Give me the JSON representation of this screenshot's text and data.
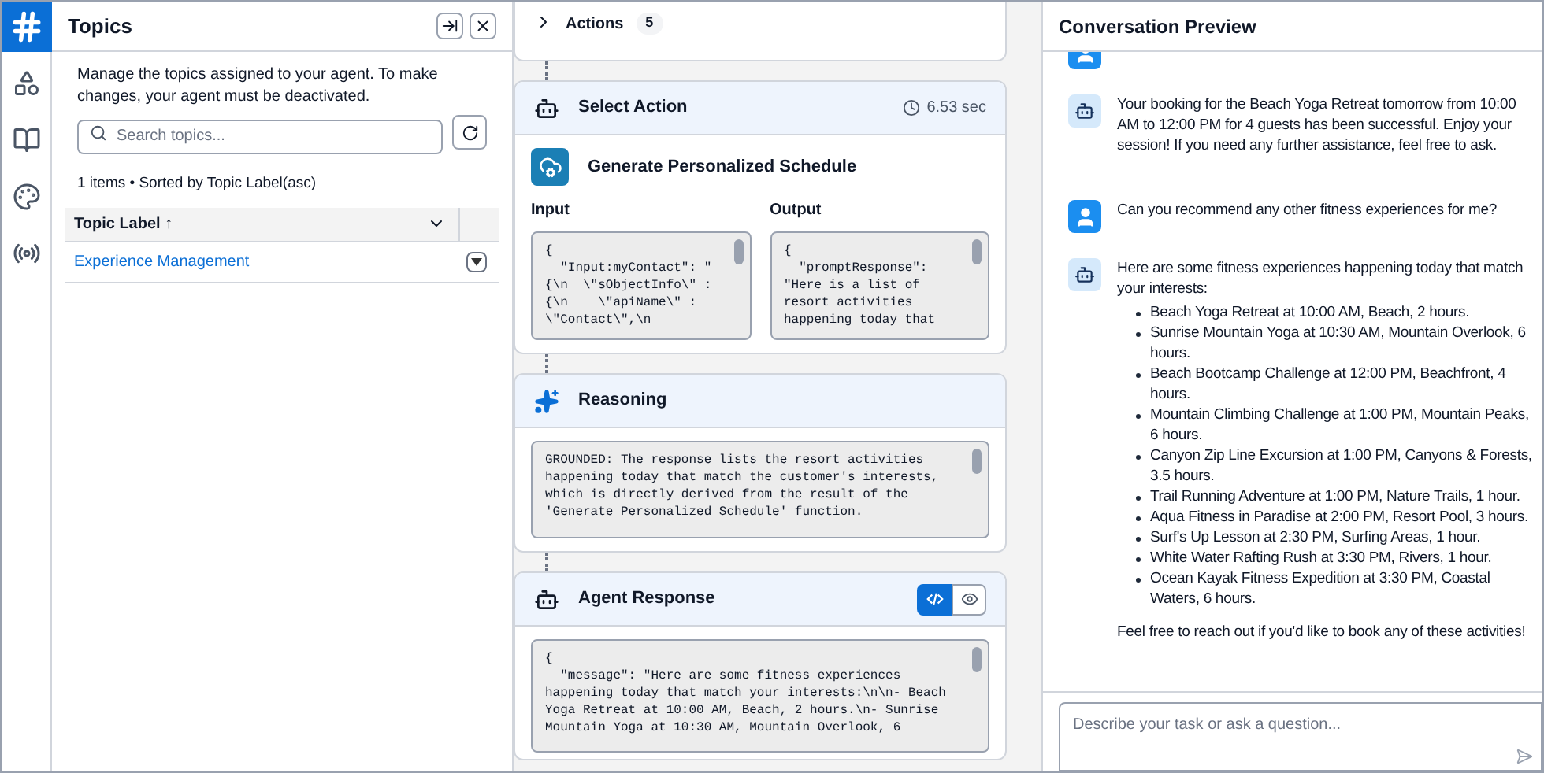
{
  "rail": [
    {
      "kind": "hash",
      "selected": true
    },
    {
      "kind": "shapes",
      "selected": false
    },
    {
      "kind": "book",
      "selected": false
    },
    {
      "kind": "palette",
      "selected": false
    },
    {
      "kind": "signal",
      "selected": false
    }
  ],
  "topics": {
    "title": "Topics",
    "description": "Manage the topics assigned to your agent. To make changes, your agent must be deactivated.",
    "search": {
      "placeholder": "Search topics..."
    },
    "summary": "1 items • Sorted by Topic Label(asc)",
    "columns": [
      "Topic Label ↑"
    ],
    "rows": [
      "Experience Management"
    ]
  },
  "trace": {
    "actions": {
      "label": "Actions",
      "count": "5",
      "expanded": false
    },
    "cards": [
      {
        "kind": "action",
        "title": "Select Action",
        "duration": "6.53 sec",
        "action_name": "Generate Personalized Schedule",
        "panes": [
          {
            "label": "Input",
            "lines": [
              "{",
              "  \"Input:myContact\": \"",
              "{\\n  \\\"sObjectInfo\\\" :",
              "{\\n    \\\"apiName\\\" :",
              "\\\"Contact\\\",\\n"
            ]
          },
          {
            "label": "Output",
            "lines": [
              "{",
              "  \"promptResponse\":",
              "\"Here is a list of",
              "resort activities",
              "happening today that"
            ]
          }
        ]
      },
      {
        "kind": "reasoning",
        "title": "Reasoning",
        "lines": [
          "GROUNDED: The response lists the resort activities",
          "happening today that match the customer's interests,",
          "which is directly derived from the result of the",
          "'Generate Personalized Schedule' function."
        ]
      },
      {
        "kind": "response",
        "title": "Agent Response",
        "views": [
          {
            "kind": "code",
            "selected": true
          },
          {
            "kind": "preview",
            "selected": false
          }
        ],
        "lines": [
          "{",
          "  \"message\": \"Here are some fitness experiences",
          "happening today that match your interests:\\n\\n- Beach",
          "Yoga Retreat at 10:00 AM, Beach, 2 hours.\\n- Sunrise",
          "Mountain Yoga at 10:30 AM, Mountain Overlook, 6"
        ]
      }
    ]
  },
  "preview": {
    "title": "Conversation Preview",
    "messages": [
      {
        "kind": "user"
      },
      {
        "kind": "agent",
        "text": "Your booking for the Beach Yoga Retreat tomorrow from 10:00 AM to 12:00 PM for 4 guests has been successful. Enjoy your session! If you need any further assistance, feel free to ask."
      },
      {
        "kind": "user",
        "text": "Can you recommend any other fitness experiences for me?"
      },
      {
        "kind": "agent",
        "text": "Here are some fitness experiences happening today that match your interests:",
        "bullets": [
          "Beach Yoga Retreat at 10:00 AM, Beach, 2 hours.",
          "Sunrise Mountain Yoga at 10:30 AM, Mountain Overlook, 6 hours.",
          "Beach Bootcamp Challenge at 12:00 PM, Beachfront, 4 hours.",
          "Mountain Climbing Challenge at 1:00 PM, Mountain Peaks, 6 hours.",
          "Canyon Zip Line Excursion at 1:00 PM, Canyons & Forests, 3.5 hours.",
          "Trail Running Adventure at 1:00 PM, Nature Trails, 1 hour.",
          "Aqua Fitness in Paradise at 2:00 PM, Resort Pool, 3 hours.",
          "Surf's Up Lesson at 2:30 PM, Surfing Areas, 1 hour.",
          "White Water Rafting Rush at 3:30 PM, Rivers, 1 hour.",
          "Ocean Kayak Fitness Expedition at 3:30 PM, Coastal Waters, 6 hours."
        ],
        "closing": "Feel free to reach out if you'd like to book any of these activities!"
      }
    ],
    "composer": {
      "placeholder": "Describe your task or ask a question..."
    }
  }
}
